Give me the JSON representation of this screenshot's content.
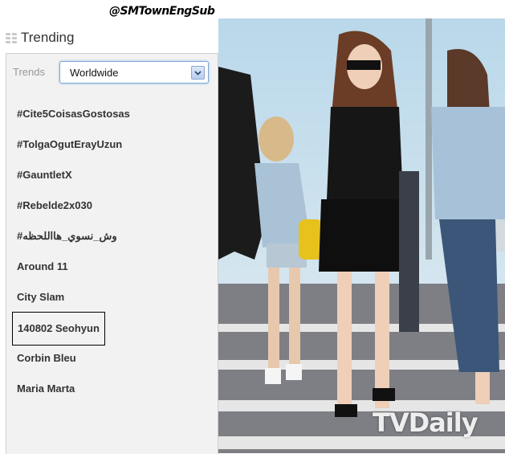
{
  "watermark": "@SMTownEngSub",
  "panel": {
    "title": "Trending",
    "trends_label": "Trends",
    "location": "Worldwide"
  },
  "trends": [
    "#Cite5CoisasGostosas",
    "#TolgaOgutErayUzun",
    "#GauntletX",
    "#Rebelde2x030",
    "#وش_نسوي_هااللحظه",
    "Around 11",
    "City Slam",
    "140802 Seohyun",
    "Corbin Bleu",
    "Maria Marta"
  ],
  "highlighted_trend": "140802 Seohyun",
  "photo_logo": "TVDaily"
}
